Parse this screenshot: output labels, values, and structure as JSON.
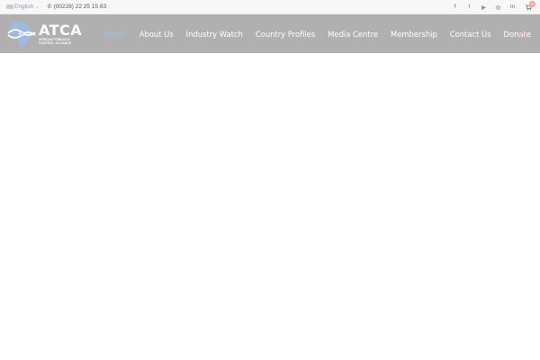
{
  "topbar": {
    "language": {
      "label": "English",
      "icon": "uk-flag-icon"
    },
    "phone": {
      "icon": "phone-icon",
      "number": "(00228) 22 25 15 83"
    },
    "social": [
      {
        "name": "facebook",
        "glyph": "f"
      },
      {
        "name": "twitter",
        "glyph": "t"
      },
      {
        "name": "youtube",
        "glyph": "▶"
      },
      {
        "name": "instagram",
        "glyph": "◎"
      },
      {
        "name": "linkedin",
        "glyph": "in"
      }
    ],
    "cart": {
      "icon": "cart-icon",
      "count": "0"
    }
  },
  "header": {
    "logo": {
      "title": "ATCA",
      "subtitle_lines": [
        "AFRICAN TOBACCO",
        "CONTROL ALLIANCE"
      ]
    },
    "nav": [
      {
        "label": "Home",
        "active": true
      },
      {
        "label": "About Us",
        "active": false
      },
      {
        "label": "Industry Watch",
        "active": false
      },
      {
        "label": "Country Profiles",
        "active": false
      },
      {
        "label": "Media Centre",
        "active": false
      },
      {
        "label": "Membership",
        "active": false
      },
      {
        "label": "Contact Us",
        "active": false
      },
      {
        "label": "Donate",
        "active": false
      }
    ],
    "search": {
      "icon": "search-icon"
    }
  },
  "colors": {
    "header_overlay": "#b0b0b0",
    "topbar_bg": "#f7f7f7",
    "nav_active": "#9cc3e6",
    "cart_badge": "#f3a3a3"
  }
}
